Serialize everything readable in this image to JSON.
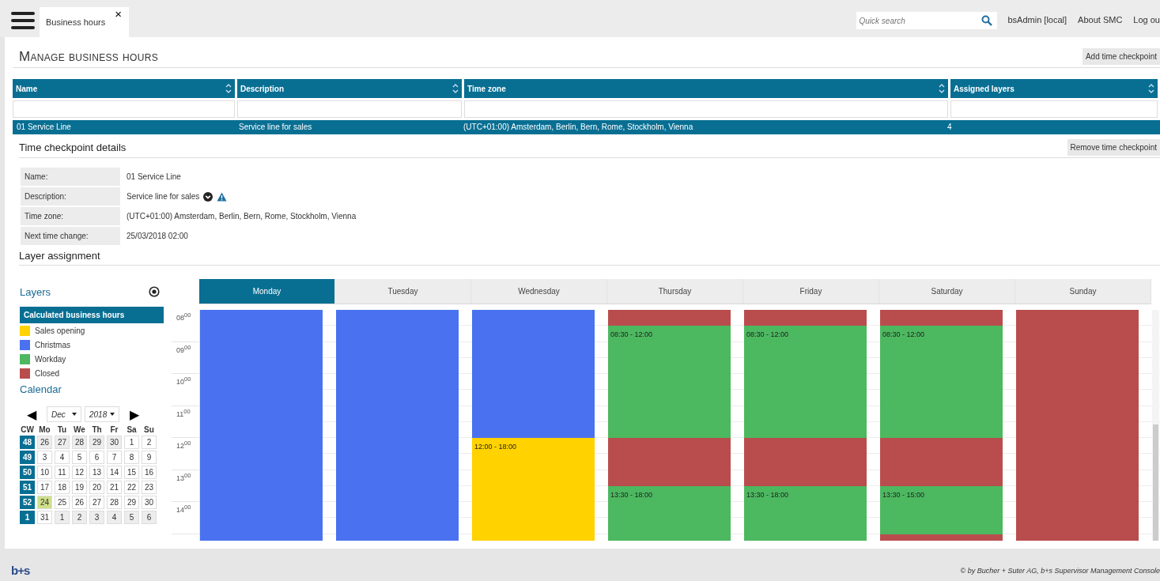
{
  "top_bar": {
    "tab": {
      "label": "Business hours",
      "close": "×"
    },
    "search": {
      "placeholder": "Quick search"
    },
    "links": [
      "bsAdmin [local]",
      "About SMC",
      "Log ou"
    ]
  },
  "page": {
    "title": "Manage business hours",
    "action": "Add time checkpoint"
  },
  "table": {
    "columns": [
      "Name",
      "Description",
      "Time zone",
      "Assigned layers"
    ],
    "rows": [
      {
        "cells": [
          "01 Service Line",
          "Service line for sales",
          "(UTC+01:00) Amsterdam, Berlin, Bern, Rome, Stockholm, Vienna",
          "4"
        ],
        "selected": true
      }
    ]
  },
  "details": {
    "title": "Time checkpoint details",
    "action": "Remove time checkpoint",
    "fields": [
      {
        "label": "Name:",
        "value": "01 Service Line",
        "kind": "text"
      },
      {
        "label": "Description:",
        "value": "Service line for sales",
        "kind": "icons"
      },
      {
        "label": "Time zone:",
        "value": "(UTC+01:00) Amsterdam, Berlin, Bern, Rome, Stockholm, Vienna",
        "kind": "text"
      },
      {
        "label": "Next time change:",
        "value": "25/03/2018 02:00",
        "kind": "text"
      }
    ]
  },
  "layer_assignment": {
    "title": "Layer assignment",
    "layers_title": "Layers",
    "calculated": "Calculated business hours",
    "layers": [
      {
        "name": "Sales opening",
        "color": "#ffd200"
      },
      {
        "name": "Christmas",
        "color": "#4a72f0"
      },
      {
        "name": "Workday",
        "color": "#4cb860"
      },
      {
        "name": "Closed",
        "color": "#b94d4d"
      }
    ],
    "calendar_title": "Calendar",
    "month": "Dec",
    "year": "2018",
    "prev": "◀",
    "next": "▶",
    "weekday_headers": [
      "CW",
      "Mo",
      "Tu",
      "We",
      "Th",
      "Fr",
      "Sa",
      "Su"
    ],
    "weeks": [
      {
        "cw": "48",
        "days": [
          {
            "d": "26",
            "other_month": true,
            "selected": false
          },
          {
            "d": "27",
            "other_month": true,
            "selected": false
          },
          {
            "d": "28",
            "other_month": true,
            "selected": false
          },
          {
            "d": "29",
            "other_month": true,
            "selected": false
          },
          {
            "d": "30",
            "other_month": true,
            "selected": false
          },
          {
            "d": "1",
            "other_month": false,
            "selected": false
          },
          {
            "d": "2",
            "other_month": false,
            "selected": false
          }
        ]
      },
      {
        "cw": "49",
        "days": [
          {
            "d": "3",
            "other_month": false,
            "selected": false
          },
          {
            "d": "4",
            "other_month": false,
            "selected": false
          },
          {
            "d": "5",
            "other_month": false,
            "selected": false
          },
          {
            "d": "6",
            "other_month": false,
            "selected": false
          },
          {
            "d": "7",
            "other_month": false,
            "selected": false
          },
          {
            "d": "8",
            "other_month": false,
            "selected": false
          },
          {
            "d": "9",
            "other_month": false,
            "selected": false
          }
        ]
      },
      {
        "cw": "50",
        "days": [
          {
            "d": "10",
            "other_month": false,
            "selected": false
          },
          {
            "d": "11",
            "other_month": false,
            "selected": false
          },
          {
            "d": "12",
            "other_month": false,
            "selected": false
          },
          {
            "d": "13",
            "other_month": false,
            "selected": false
          },
          {
            "d": "14",
            "other_month": false,
            "selected": false
          },
          {
            "d": "15",
            "other_month": false,
            "selected": false
          },
          {
            "d": "16",
            "other_month": false,
            "selected": false
          }
        ]
      },
      {
        "cw": "51",
        "days": [
          {
            "d": "17",
            "other_month": false,
            "selected": false
          },
          {
            "d": "18",
            "other_month": false,
            "selected": false
          },
          {
            "d": "19",
            "other_month": false,
            "selected": false
          },
          {
            "d": "20",
            "other_month": false,
            "selected": false
          },
          {
            "d": "21",
            "other_month": false,
            "selected": false
          },
          {
            "d": "22",
            "other_month": false,
            "selected": false
          },
          {
            "d": "23",
            "other_month": false,
            "selected": false
          }
        ]
      },
      {
        "cw": "52",
        "days": [
          {
            "d": "24",
            "other_month": false,
            "selected": true
          },
          {
            "d": "25",
            "other_month": false,
            "selected": false
          },
          {
            "d": "26",
            "other_month": false,
            "selected": false
          },
          {
            "d": "27",
            "other_month": false,
            "selected": false
          },
          {
            "d": "28",
            "other_month": false,
            "selected": false
          },
          {
            "d": "29",
            "other_month": false,
            "selected": false
          },
          {
            "d": "30",
            "other_month": false,
            "selected": false
          }
        ]
      },
      {
        "cw": "1",
        "days": [
          {
            "d": "31",
            "other_month": false,
            "selected": false
          },
          {
            "d": "1",
            "other_month": true,
            "selected": false
          },
          {
            "d": "2",
            "other_month": true,
            "selected": false
          },
          {
            "d": "3",
            "other_month": true,
            "selected": false
          },
          {
            "d": "4",
            "other_month": true,
            "selected": false
          },
          {
            "d": "5",
            "other_month": true,
            "selected": false
          },
          {
            "d": "6",
            "other_month": true,
            "selected": false
          }
        ]
      }
    ],
    "hours": [
      "08$^{00}$",
      "09$^{00}$",
      "10$^{00}$",
      "11$^{00}$",
      "12$^{00}$",
      "13$^{00}$",
      "14$^{00}$"
    ],
    "days": [
      {
        "name": "Monday",
        "selected": true,
        "half_hour_slots": [
          {
            "color": "#4a72f0"
          },
          {
            "color": "#4a72f0"
          },
          {
            "color": "#4a72f0"
          },
          {
            "color": "#4a72f0"
          },
          {
            "color": "#4a72f0"
          },
          {
            "color": "#4a72f0"
          },
          {
            "color": "#4a72f0"
          },
          {
            "color": "#4a72f0"
          },
          {
            "color": "#4a72f0"
          },
          {
            "color": "#4a72f0"
          },
          {
            "color": "#4a72f0"
          },
          {
            "color": "#4a72f0"
          },
          {
            "color": "#4a72f0"
          },
          {
            "color": "#4a72f0"
          },
          {
            "color": "#4a72f0"
          }
        ]
      },
      {
        "name": "Tuesday",
        "selected": false,
        "half_hour_slots": [
          {
            "color": "#4a72f0"
          },
          {
            "color": "#4a72f0"
          },
          {
            "color": "#4a72f0"
          },
          {
            "color": "#4a72f0"
          },
          {
            "color": "#4a72f0"
          },
          {
            "color": "#4a72f0"
          },
          {
            "color": "#4a72f0"
          },
          {
            "color": "#4a72f0"
          },
          {
            "color": "#4a72f0"
          },
          {
            "color": "#4a72f0"
          },
          {
            "color": "#4a72f0"
          },
          {
            "color": "#4a72f0"
          },
          {
            "color": "#4a72f0"
          },
          {
            "color": "#4a72f0"
          },
          {
            "color": "#4a72f0"
          }
        ]
      },
      {
        "name": "Wednesday",
        "selected": false,
        "half_hour_slots": [
          {
            "color": "#4a72f0"
          },
          {
            "color": "#4a72f0"
          },
          {
            "color": "#4a72f0"
          },
          {
            "color": "#4a72f0"
          },
          {
            "color": "#4a72f0"
          },
          {
            "color": "#4a72f0"
          },
          {
            "color": "#4a72f0"
          },
          {
            "color": "#4a72f0"
          },
          {
            "color": "#ffd200",
            "label": "12:00 - 18:00"
          },
          {
            "color": "#ffd200"
          },
          {
            "color": "#ffd200"
          },
          {
            "color": "#ffd200"
          },
          {
            "color": "#ffd200"
          },
          {
            "color": "#ffd200"
          },
          {
            "color": "#ffd200"
          }
        ]
      },
      {
        "name": "Thursday",
        "selected": false,
        "half_hour_slots": [
          {
            "color": "#b94d4d"
          },
          {
            "color": "#4cb860",
            "label": "08:30 - 12:00"
          },
          {
            "color": "#4cb860"
          },
          {
            "color": "#4cb860"
          },
          {
            "color": "#4cb860"
          },
          {
            "color": "#4cb860"
          },
          {
            "color": "#4cb860"
          },
          {
            "color": "#4cb860"
          },
          {
            "color": "#b94d4d"
          },
          {
            "color": "#b94d4d"
          },
          {
            "color": "#b94d4d"
          },
          {
            "color": "#4cb860",
            "label": "13:30 - 18:00"
          },
          {
            "color": "#4cb860"
          },
          {
            "color": "#4cb860"
          },
          {
            "color": "#4cb860"
          }
        ]
      },
      {
        "name": "Friday",
        "selected": false,
        "half_hour_slots": [
          {
            "color": "#b94d4d"
          },
          {
            "color": "#4cb860",
            "label": "08:30 - 12:00"
          },
          {
            "color": "#4cb860"
          },
          {
            "color": "#4cb860"
          },
          {
            "color": "#4cb860"
          },
          {
            "color": "#4cb860"
          },
          {
            "color": "#4cb860"
          },
          {
            "color": "#4cb860"
          },
          {
            "color": "#b94d4d"
          },
          {
            "color": "#b94d4d"
          },
          {
            "color": "#b94d4d"
          },
          {
            "color": "#4cb860",
            "label": "13:30 - 18:00"
          },
          {
            "color": "#4cb860"
          },
          {
            "color": "#4cb860"
          },
          {
            "color": "#4cb860"
          }
        ]
      },
      {
        "name": "Saturday",
        "selected": false,
        "half_hour_slots": [
          {
            "color": "#b94d4d"
          },
          {
            "color": "#4cb860",
            "label": "08:30 - 12:00"
          },
          {
            "color": "#4cb860"
          },
          {
            "color": "#4cb860"
          },
          {
            "color": "#4cb860"
          },
          {
            "color": "#4cb860"
          },
          {
            "color": "#4cb860"
          },
          {
            "color": "#4cb860"
          },
          {
            "color": "#b94d4d"
          },
          {
            "color": "#b94d4d"
          },
          {
            "color": "#b94d4d"
          },
          {
            "color": "#4cb860",
            "label": "13:30 - 15:00"
          },
          {
            "color": "#4cb860"
          },
          {
            "color": "#4cb860"
          },
          {
            "color": "#b94d4d"
          }
        ]
      },
      {
        "name": "Sunday",
        "selected": false,
        "half_hour_slots": [
          {
            "color": "#b94d4d"
          },
          {
            "color": "#b94d4d"
          },
          {
            "color": "#b94d4d"
          },
          {
            "color": "#b94d4d"
          },
          {
            "color": "#b94d4d"
          },
          {
            "color": "#b94d4d"
          },
          {
            "color": "#b94d4d"
          },
          {
            "color": "#b94d4d"
          },
          {
            "color": "#b94d4d"
          },
          {
            "color": "#b94d4d"
          },
          {
            "color": "#b94d4d"
          },
          {
            "color": "#b94d4d"
          },
          {
            "color": "#b94d4d"
          },
          {
            "color": "#b94d4d"
          },
          {
            "color": "#b94d4d"
          }
        ]
      }
    ]
  },
  "footer": {
    "logo": "b+s",
    "copyright": "© by Bucher + Suter AG, b+s Supervisor Management Console"
  }
}
